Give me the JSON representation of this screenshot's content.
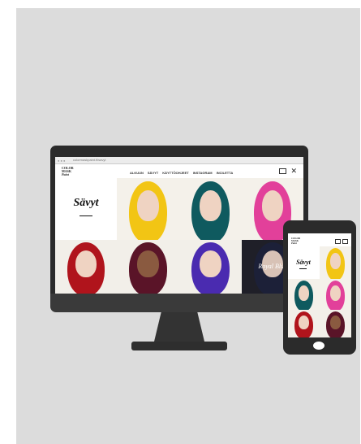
{
  "colors": {
    "background_panel": "#dcdcdc",
    "device_frame": "#2b2b2b",
    "screen_bg": "#ffffff"
  },
  "browser": {
    "url": "colormaskpaint.fi/savyt"
  },
  "site": {
    "brand_lines": [
      "COLOR",
      "MASK",
      "Paint"
    ],
    "nav": [
      "ALKUUN",
      "SÄVYT",
      "KÄYTTÖOHJEET",
      "INSTAGRAM",
      "INCILETTA"
    ],
    "cart_icon": "cart-icon",
    "close_icon": "close-icon",
    "page_title": "Sävyt",
    "tiles": [
      {
        "name": "yellow",
        "hair": "#f2c514",
        "label": ""
      },
      {
        "name": "teal",
        "hair": "#0f5a5f",
        "label": ""
      },
      {
        "name": "pink",
        "hair": "#e2409a",
        "label": ""
      },
      {
        "name": "red",
        "hair": "#b0141c",
        "label": ""
      },
      {
        "name": "plum",
        "hair": "#5a1428",
        "label": ""
      },
      {
        "name": "violet",
        "hair": "#4a2bb0",
        "label": ""
      },
      {
        "name": "blue",
        "hair": "#1c2038",
        "label": "Royal Blue"
      }
    ]
  },
  "mobile": {
    "brand_lines": [
      "COLOR",
      "MASK",
      "Paint"
    ],
    "page_title": "Sävyt"
  }
}
